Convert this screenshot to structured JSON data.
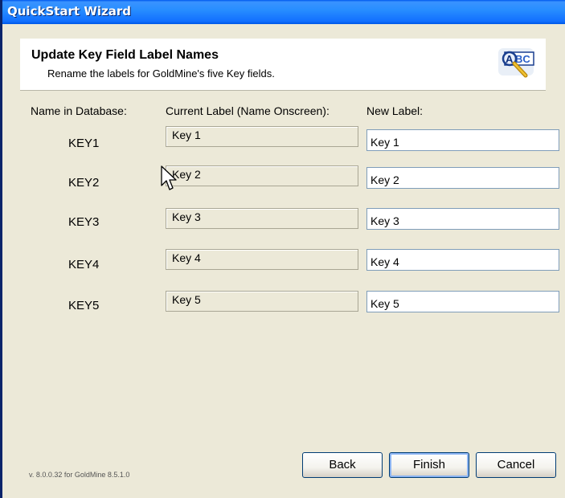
{
  "window": {
    "title": "QuickStart Wizard"
  },
  "header": {
    "title": "Update Key Field Label Names",
    "subtitle": "Rename the labels for GoldMine's five Key fields.",
    "icon": "abc-rename-icon"
  },
  "columns": {
    "name_in_database": "Name in Database:",
    "current_label": "Current Label (Name Onscreen):",
    "new_label": "New Label:"
  },
  "rows": [
    {
      "db_name": "KEY1",
      "current": "Key 1",
      "new_value": "Key 1"
    },
    {
      "db_name": "KEY2",
      "current": "Key 2",
      "new_value": "Key 2"
    },
    {
      "db_name": "KEY3",
      "current": "Key 3",
      "new_value": "Key 3"
    },
    {
      "db_name": "KEY4",
      "current": "Key 4",
      "new_value": "Key 4"
    },
    {
      "db_name": "KEY5",
      "current": "Key 5",
      "new_value": "Key 5"
    }
  ],
  "footer": {
    "version": "v. 8.0.0.32 for GoldMine 8.5.1.0",
    "back_label": "Back",
    "finish_label": "Finish",
    "cancel_label": "Cancel"
  },
  "colors": {
    "title_bar": "#0058EE",
    "dialog_bg": "#ECE9D8",
    "input_border": "#7F9DB9"
  }
}
